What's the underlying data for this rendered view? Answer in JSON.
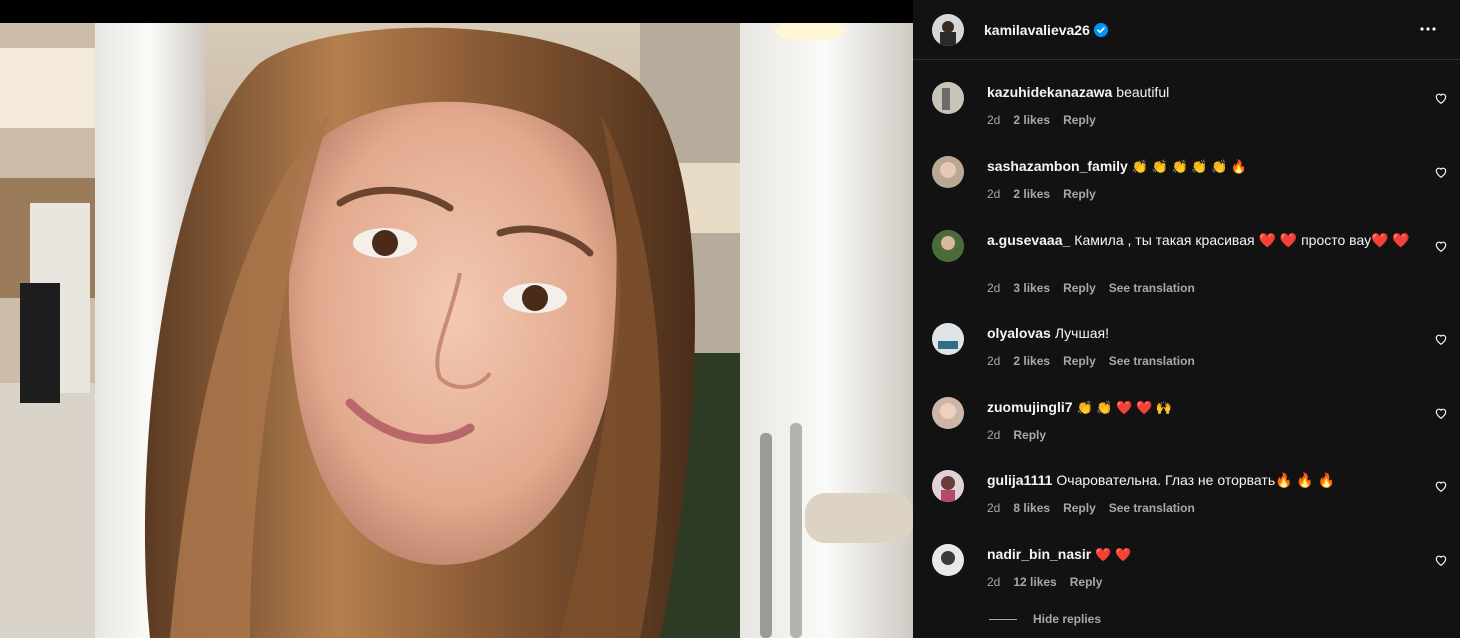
{
  "post": {
    "owner": {
      "username": "kamilavalieva26",
      "verified": true
    },
    "more_icon": "ellipsis-icon"
  },
  "comments": [
    {
      "username": "kazuhidekanazawa",
      "text": "beautiful",
      "time": "2d",
      "likes": "2 likes",
      "reply": "Reply",
      "translate": ""
    },
    {
      "username": "sashazambon_family",
      "text": "👏 👏 👏 👏 👏 🔥",
      "time": "2d",
      "likes": "2 likes",
      "reply": "Reply",
      "translate": ""
    },
    {
      "username": "a.gusevaaa_",
      "text": "Камила , ты такая красивая ❤️ ❤️ просто вау❤️ ❤️",
      "time": "2d",
      "likes": "3 likes",
      "reply": "Reply",
      "translate": "See translation"
    },
    {
      "username": "olyalovas",
      "text": "Лучшая!",
      "time": "2d",
      "likes": "2 likes",
      "reply": "Reply",
      "translate": "See translation"
    },
    {
      "username": "zuomujingli7",
      "text": "👏 👏 ❤️ ❤️ 🙌",
      "time": "2d",
      "likes": "",
      "reply": "Reply",
      "translate": ""
    },
    {
      "username": "gulija1111",
      "text": "Очаровательна. Глаз не оторвать🔥 🔥 🔥",
      "time": "2d",
      "likes": "8 likes",
      "reply": "Reply",
      "translate": "See translation"
    },
    {
      "username": "nadir_bin_nasir",
      "text": "❤️ ❤️",
      "time": "2d",
      "likes": "12 likes",
      "reply": "Reply",
      "translate": ""
    }
  ],
  "hide_replies": "Hide replies",
  "colors": {
    "panel_bg": "#121212",
    "text": "#f5f5f5",
    "secondary": "#a8a8a8",
    "verified": "#0095f6"
  }
}
